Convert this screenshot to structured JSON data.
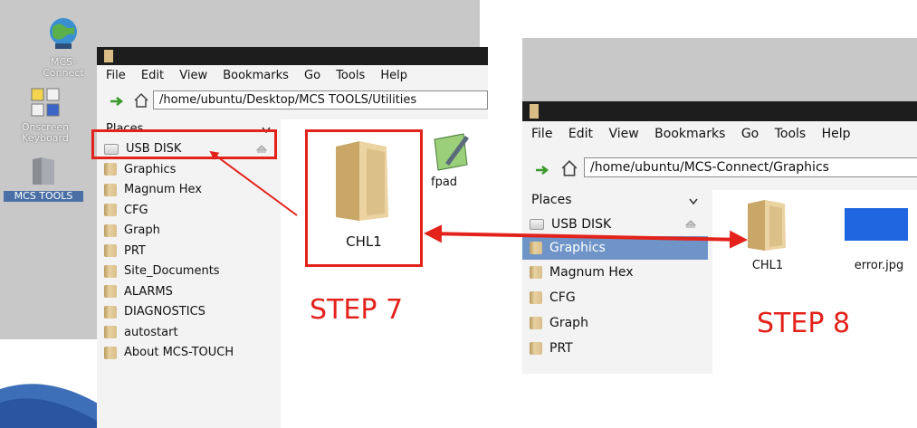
{
  "desktop": {
    "icons": [
      {
        "label_lines": [
          "MCS-",
          "Connect"
        ],
        "icon": "globe-network-icon"
      },
      {
        "label_lines": [
          "Onscreen",
          "Keyboard"
        ],
        "icon": "keyboard-icon"
      },
      {
        "label_lines": [
          "MCS TOOLS"
        ],
        "icon": "folder-icon"
      }
    ]
  },
  "step7_window": {
    "menu": [
      "File",
      "Edit",
      "View",
      "Bookmarks",
      "Go",
      "Tools",
      "Help"
    ],
    "path": "/home/ubuntu/Desktop/MCS TOOLS/Utilities",
    "places_header": "Places",
    "places": [
      "USB DISK",
      "Graphics",
      "Magnum Hex",
      "CFG",
      "Graph",
      "PRT",
      "Site_Documents",
      "ALARMS",
      "DIAGNOSTICS",
      "autostart",
      "About MCS-TOUCH"
    ],
    "folder_label": "CHL1",
    "partial_item_label": "fpad"
  },
  "step8_window": {
    "menu": [
      "File",
      "Edit",
      "View",
      "Bookmarks",
      "Go",
      "Tools",
      "Help"
    ],
    "path": "/home/ubuntu/MCS-Connect/Graphics",
    "places_header": "Places",
    "places": [
      "USB DISK",
      "Graphics",
      "Magnum Hex",
      "CFG",
      "Graph",
      "PRT"
    ],
    "files": [
      {
        "label": "CHL1",
        "icon": "folder-icon"
      },
      {
        "label": "error.jpg",
        "icon": "image-file-icon"
      }
    ]
  },
  "annotations": {
    "step7": "STEP 7",
    "step8": "STEP 8",
    "color": "#e3231b"
  }
}
